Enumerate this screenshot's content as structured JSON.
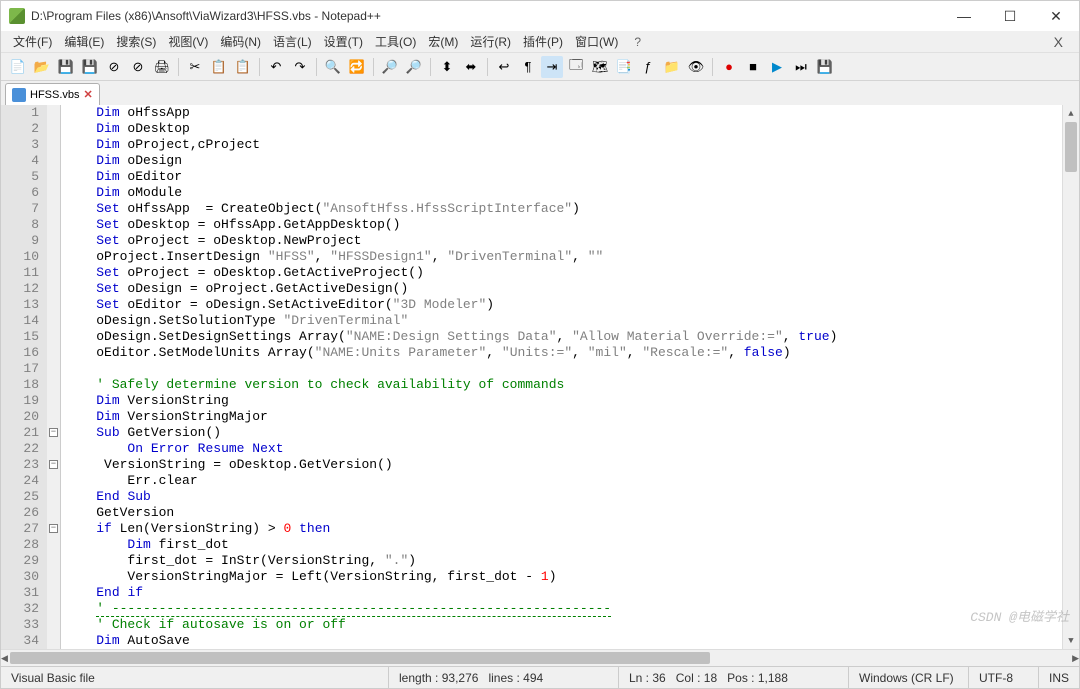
{
  "window": {
    "title": "D:\\Program Files (x86)\\Ansoft\\ViaWizard3\\HFSS.vbs - Notepad++"
  },
  "menu": {
    "items": [
      "文件(F)",
      "编辑(E)",
      "搜索(S)",
      "视图(V)",
      "编码(N)",
      "语言(L)",
      "设置(T)",
      "工具(O)",
      "宏(M)",
      "运行(R)",
      "插件(P)",
      "窗口(W)"
    ],
    "help": "?",
    "close": "X"
  },
  "tab": {
    "label": "HFSS.vbs",
    "close": "✕"
  },
  "code": {
    "lines": [
      {
        "n": 1,
        "tokens": [
          {
            "t": "Dim",
            "c": "kw"
          },
          {
            "t": " oHfssApp"
          }
        ]
      },
      {
        "n": 2,
        "tokens": [
          {
            "t": "Dim",
            "c": "kw"
          },
          {
            "t": " oDesktop"
          }
        ]
      },
      {
        "n": 3,
        "tokens": [
          {
            "t": "Dim",
            "c": "kw"
          },
          {
            "t": " oProject,cProject"
          }
        ]
      },
      {
        "n": 4,
        "tokens": [
          {
            "t": "Dim",
            "c": "kw"
          },
          {
            "t": " oDesign"
          }
        ]
      },
      {
        "n": 5,
        "tokens": [
          {
            "t": "Dim",
            "c": "kw"
          },
          {
            "t": " oEditor"
          }
        ]
      },
      {
        "n": 6,
        "tokens": [
          {
            "t": "Dim",
            "c": "kw"
          },
          {
            "t": " oModule"
          }
        ]
      },
      {
        "n": 7,
        "tokens": [
          {
            "t": "Set",
            "c": "kw"
          },
          {
            "t": " oHfssApp  = CreateObject("
          },
          {
            "t": "\"AnsoftHfss.HfssScriptInterface\"",
            "c": "str"
          },
          {
            "t": ")"
          }
        ]
      },
      {
        "n": 8,
        "tokens": [
          {
            "t": "Set",
            "c": "kw"
          },
          {
            "t": " oDesktop = oHfssApp.GetAppDesktop()"
          }
        ]
      },
      {
        "n": 9,
        "tokens": [
          {
            "t": "Set",
            "c": "kw"
          },
          {
            "t": " oProject = oDesktop.NewProject"
          }
        ]
      },
      {
        "n": 10,
        "tokens": [
          {
            "t": "oProject.InsertDesign "
          },
          {
            "t": "\"HFSS\"",
            "c": "str"
          },
          {
            "t": ", "
          },
          {
            "t": "\"HFSSDesign1\"",
            "c": "str"
          },
          {
            "t": ", "
          },
          {
            "t": "\"DrivenTerminal\"",
            "c": "str"
          },
          {
            "t": ", "
          },
          {
            "t": "\"\"",
            "c": "str"
          }
        ]
      },
      {
        "n": 11,
        "tokens": [
          {
            "t": "Set",
            "c": "kw"
          },
          {
            "t": " oProject = oDesktop.GetActiveProject()"
          }
        ]
      },
      {
        "n": 12,
        "tokens": [
          {
            "t": "Set",
            "c": "kw"
          },
          {
            "t": " oDesign = oProject.GetActiveDesign()"
          }
        ]
      },
      {
        "n": 13,
        "tokens": [
          {
            "t": "Set",
            "c": "kw"
          },
          {
            "t": " oEditor = oDesign.SetActiveEditor("
          },
          {
            "t": "\"3D Modeler\"",
            "c": "str"
          },
          {
            "t": ")"
          }
        ]
      },
      {
        "n": 14,
        "tokens": [
          {
            "t": "oDesign.SetSolutionType "
          },
          {
            "t": "\"DrivenTerminal\"",
            "c": "str"
          }
        ]
      },
      {
        "n": 15,
        "tokens": [
          {
            "t": "oDesign.SetDesignSettings Array("
          },
          {
            "t": "\"NAME:Design Settings Data\"",
            "c": "str"
          },
          {
            "t": ", "
          },
          {
            "t": "\"Allow Material Override:=\"",
            "c": "str"
          },
          {
            "t": ", "
          },
          {
            "t": "true",
            "c": "kw"
          },
          {
            "t": ")"
          }
        ]
      },
      {
        "n": 16,
        "tokens": [
          {
            "t": "oEditor.SetModelUnits Array("
          },
          {
            "t": "\"NAME:Units Parameter\"",
            "c": "str"
          },
          {
            "t": ", "
          },
          {
            "t": "\"Units:=\"",
            "c": "str"
          },
          {
            "t": ", "
          },
          {
            "t": "\"mil\"",
            "c": "str"
          },
          {
            "t": ", "
          },
          {
            "t": "\"Rescale:=\"",
            "c": "str"
          },
          {
            "t": ", "
          },
          {
            "t": "false",
            "c": "kw"
          },
          {
            "t": ")"
          }
        ]
      },
      {
        "n": 17,
        "tokens": [
          {
            "t": ""
          }
        ]
      },
      {
        "n": 18,
        "tokens": [
          {
            "t": "' Safely determine version to check availability of commands",
            "c": "cmt"
          }
        ]
      },
      {
        "n": 19,
        "tokens": [
          {
            "t": "Dim",
            "c": "kw"
          },
          {
            "t": " VersionString"
          }
        ]
      },
      {
        "n": 20,
        "tokens": [
          {
            "t": "Dim",
            "c": "kw"
          },
          {
            "t": " VersionStringMajor"
          }
        ]
      },
      {
        "n": 21,
        "fold": "⊟",
        "tokens": [
          {
            "t": "Sub",
            "c": "kw"
          },
          {
            "t": " GetVersion()"
          }
        ]
      },
      {
        "n": 22,
        "foldline": true,
        "indent": 1,
        "tokens": [
          {
            "t": "On",
            "c": "kw"
          },
          {
            "t": " "
          },
          {
            "t": "Error",
            "c": "kw"
          },
          {
            "t": " "
          },
          {
            "t": "Resume",
            "c": "kw"
          },
          {
            "t": " "
          },
          {
            "t": "Next",
            "c": "kw"
          }
        ]
      },
      {
        "n": 23,
        "fold": "⊟",
        "tokens": [
          {
            "t": " VersionString = oDesktop.GetVersion()"
          }
        ]
      },
      {
        "n": 24,
        "foldline": true,
        "indent": 1,
        "tokens": [
          {
            "t": "Err.clear"
          }
        ]
      },
      {
        "n": 25,
        "tokens": [
          {
            "t": "End",
            "c": "kw"
          },
          {
            "t": " "
          },
          {
            "t": "Sub",
            "c": "kw"
          }
        ]
      },
      {
        "n": 26,
        "tokens": [
          {
            "t": "GetVersion"
          }
        ]
      },
      {
        "n": 27,
        "fold": "⊟",
        "tokens": [
          {
            "t": "if",
            "c": "kw"
          },
          {
            "t": " Len(VersionString) > "
          },
          {
            "t": "0",
            "c": "num"
          },
          {
            "t": " "
          },
          {
            "t": "then",
            "c": "kw"
          }
        ]
      },
      {
        "n": 28,
        "foldline": true,
        "indent": 1,
        "tokens": [
          {
            "t": "Dim",
            "c": "kw"
          },
          {
            "t": " first_dot"
          }
        ]
      },
      {
        "n": 29,
        "foldline": true,
        "indent": 1,
        "tokens": [
          {
            "t": "first_dot = InStr(VersionString, "
          },
          {
            "t": "\".\"",
            "c": "str"
          },
          {
            "t": ")"
          }
        ]
      },
      {
        "n": 30,
        "foldline": true,
        "indent": 1,
        "tokens": [
          {
            "t": "VersionStringMajor = Left(VersionString, first_dot - "
          },
          {
            "t": "1",
            "c": "num"
          },
          {
            "t": ")"
          }
        ]
      },
      {
        "n": 31,
        "tokens": [
          {
            "t": "End",
            "c": "kw"
          },
          {
            "t": " "
          },
          {
            "t": "if",
            "c": "kw"
          }
        ]
      },
      {
        "n": 32,
        "tokens": [
          {
            "t": "' ----------------------------------------------------------------",
            "c": "cmt dash"
          }
        ]
      },
      {
        "n": 33,
        "tokens": [
          {
            "t": "' Check if autosave is on or off",
            "c": "cmt"
          }
        ]
      },
      {
        "n": 34,
        "tokens": [
          {
            "t": "Dim",
            "c": "kw"
          },
          {
            "t": " AutoSave"
          }
        ]
      }
    ]
  },
  "status": {
    "lang": "Visual Basic file",
    "length_label": "length :",
    "length": "93,276",
    "lines_label": "lines :",
    "lines": "494",
    "ln_label": "Ln :",
    "ln": "36",
    "col_label": "Col :",
    "col": "18",
    "pos_label": "Pos :",
    "pos": "1,188",
    "eol": "Windows (CR LF)",
    "encoding": "UTF-8",
    "ins": "INS"
  },
  "watermark": "CSDN @电磁学社"
}
